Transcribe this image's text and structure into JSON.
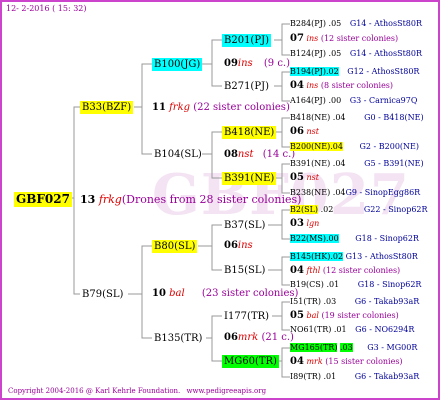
{
  "header": {
    "date": "12-  2-2016 ( 15: 32)"
  },
  "footer": {
    "copyright": "Copyright 2004-2016 @ Karl Kehrle Foundation.",
    "url": "www.pedigreeapis.org"
  },
  "watermark": "GBF027",
  "root": {
    "id": "GBF027",
    "gen": "13",
    "name": "frkg",
    "note": "(Drones from 28 sister colonies)"
  },
  "gen1": {
    "top": {
      "id": "B33(BZF)",
      "gen": "11",
      "name": "frkg",
      "note": "(22 sister colonies)"
    },
    "bottom": {
      "id": "B79(SL)",
      "gen": "10",
      "name": "bal",
      "note": "(23 sister colonies)"
    }
  },
  "gen2": {
    "a": {
      "id": "B100(JG)",
      "gen": "09",
      "name": "ins",
      "note": "(9 c.)"
    },
    "b": {
      "id": "B104(SL)",
      "gen": "08",
      "name": "nst",
      "note": "(14 c.)"
    },
    "c": {
      "id": "B80(SL)",
      "gen": "06",
      "name": "ins",
      "note": ""
    },
    "d": {
      "id": "B135(TR)",
      "gen": "06",
      "name": "mrk",
      "note": "(21 c.)"
    }
  },
  "gen3": {
    "a1": "B201(PJ)",
    "a2": "B271(PJ)",
    "b1": "B418(NE)",
    "b2": "B391(NE)",
    "c1": "B37(SL)",
    "c2": "B15(SL)",
    "d1": "I177(TR)",
    "d2": "MG60(TR)"
  },
  "gen4": [
    {
      "id": "B284(PJ)",
      "val": ".05",
      "ref": "G14 - AthosSt80R"
    },
    {
      "gen": "07",
      "name": "ins",
      "note": "(12 sister colonies)"
    },
    {
      "id": "B124(PJ)",
      "val": ".05",
      "ref": "G14 - AthosSt80R"
    },
    {
      "id": "B194(PJ)",
      "val": ".02",
      "ref": "G12 - AthosSt80R"
    },
    {
      "gen": "04",
      "name": "ins",
      "note": "(8 sister colonies)"
    },
    {
      "id": "A164(PJ)",
      "val": ".00",
      "ref": "G3 - Carnica97Q"
    },
    {
      "id": "B418(NE)",
      "val": ".04",
      "ref": "G0 - B418(NE)"
    },
    {
      "gen": "06",
      "name": "nst",
      "note": ""
    },
    {
      "id": "B200(NE)",
      "val": ".04",
      "ref": "G2 - B200(NE)"
    },
    {
      "id": "B391(NE)",
      "val": ".04",
      "ref": "G5 - B391(NE)"
    },
    {
      "gen": "05",
      "name": "nst",
      "note": ""
    },
    {
      "id": "B238(NE)",
      "val": ".04",
      "ref": "G9 - SinopEgg86R"
    },
    {
      "id": "B2(SL)",
      "val": ".02",
      "ref": "G22 - Sinop62R"
    },
    {
      "gen": "03",
      "name": "lgn",
      "note": ""
    },
    {
      "id": "B22(MS)",
      "val": ".00",
      "ref": "G18 - Sinop62R"
    },
    {
      "id": "B145(HK)",
      "val": ".02",
      "ref": "G13 - AthosSt80R"
    },
    {
      "gen": "04",
      "name": "fthl",
      "note": "(12 sister colonies)"
    },
    {
      "id": "B19(CS)",
      "val": ".01",
      "ref": "G18 - Sinop62R"
    },
    {
      "id": "I51(TR)",
      "val": ".03",
      "ref": "G6 - Takab93aR"
    },
    {
      "gen": "05",
      "name": "bal",
      "note": "(19 sister colonies)"
    },
    {
      "id": "NO61(TR)",
      "val": ".01",
      "ref": "G6 - NO6294R"
    },
    {
      "id": "MG165(TR)",
      "val": ".03",
      "ref": "G3 - MG00R"
    },
    {
      "gen": "04",
      "name": "mrk",
      "note": "(15 sister colonies)"
    },
    {
      "id": "I89(TR)",
      "val": ".01",
      "ref": "G6 - Takab93aR"
    }
  ],
  "colors": {
    "border": "#cc44cc",
    "line": "#999999",
    "yellow": "#ffff00",
    "cyan": "#00ffff",
    "green": "#00ff00",
    "purple": "#990099",
    "blue": "#000099",
    "red": "#dd0000"
  }
}
